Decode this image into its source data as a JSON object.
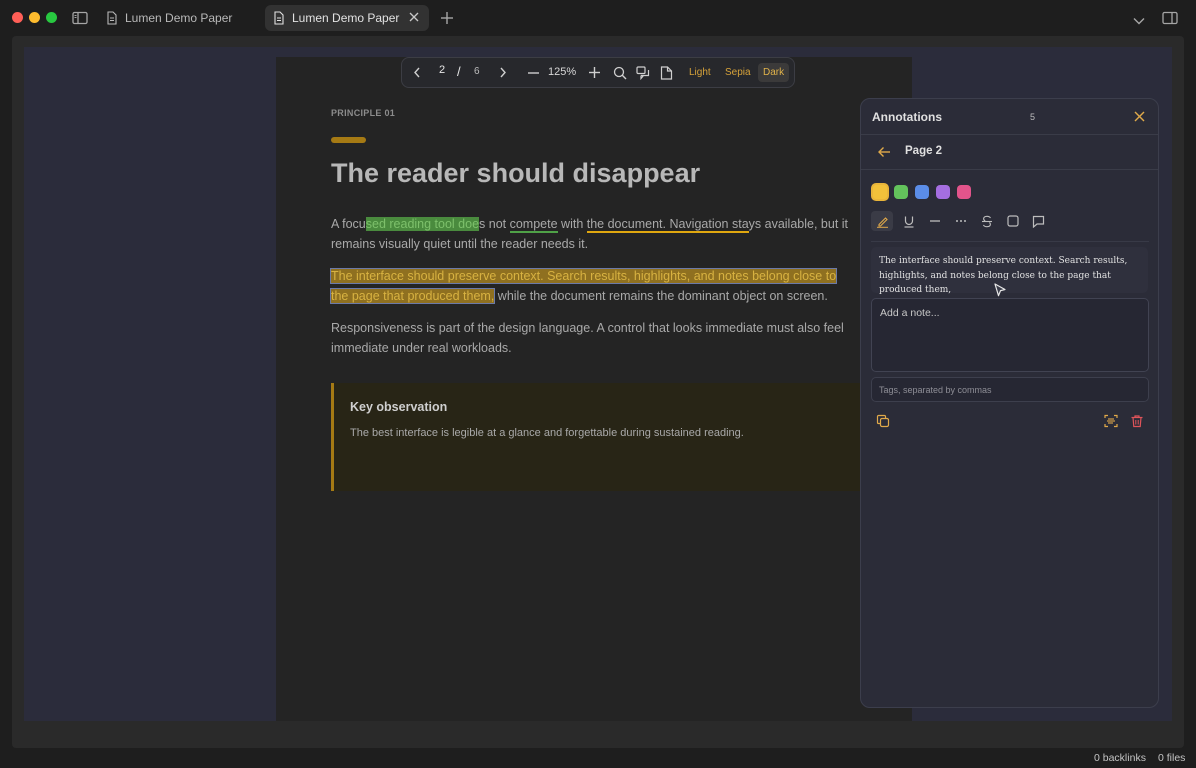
{
  "tabs": [
    {
      "title": "Lumen Demo Paper",
      "active": false
    },
    {
      "title": "Lumen Demo Paper",
      "active": true
    }
  ],
  "toolbar": {
    "current_page": "2",
    "separator": "/",
    "total_pages": "6",
    "zoom": "125%",
    "themes": [
      "Light",
      "Sepia",
      "Dark"
    ],
    "active_theme": "Dark"
  },
  "document": {
    "eyebrow": "PRINCIPLE 01",
    "title": "The reader should disappear",
    "p1": {
      "t1": "A focu",
      "t2": "sed reading tool doe",
      "t3": "s not ",
      "t4": "compete",
      "t5": " with ",
      "t6": "the document. Navigation sta",
      "t7": "ys available, but it remains visually quiet until the reader needs it."
    },
    "p2": {
      "highlighted": "The interface should preserve context. Search results, highlights, and notes belong close to the page that produced them,",
      "rest": " while the document remains the dominant object on screen."
    },
    "p3": "Responsiveness is part of the design language. A control that looks immediate must also feel immediate under real workloads.",
    "callout": {
      "title": "Key observation",
      "body": "The best interface is legible at a glance and forgettable during sustained reading."
    }
  },
  "annotations_panel": {
    "title": "Annotations",
    "count": "5",
    "page_label": "Page 2",
    "colors": [
      "#f2c13a",
      "#63c35c",
      "#5b8de8",
      "#a56ee0",
      "#e2548b"
    ],
    "selected_color": "#f2c13a",
    "tools": [
      "highlight-icon",
      "underline-icon",
      "strikethrough-line-icon",
      "dotted-line-icon",
      "strikethrough-icon",
      "box-icon",
      "comment-icon"
    ],
    "quote": "The interface should preserve context. Search results, highlights, and notes belong close to the page that produced them,",
    "note_placeholder": "Add a note...",
    "tags_placeholder": "Tags, separated by commas"
  },
  "status_bar": {
    "backlinks": "0 backlinks",
    "files": "0 files"
  }
}
